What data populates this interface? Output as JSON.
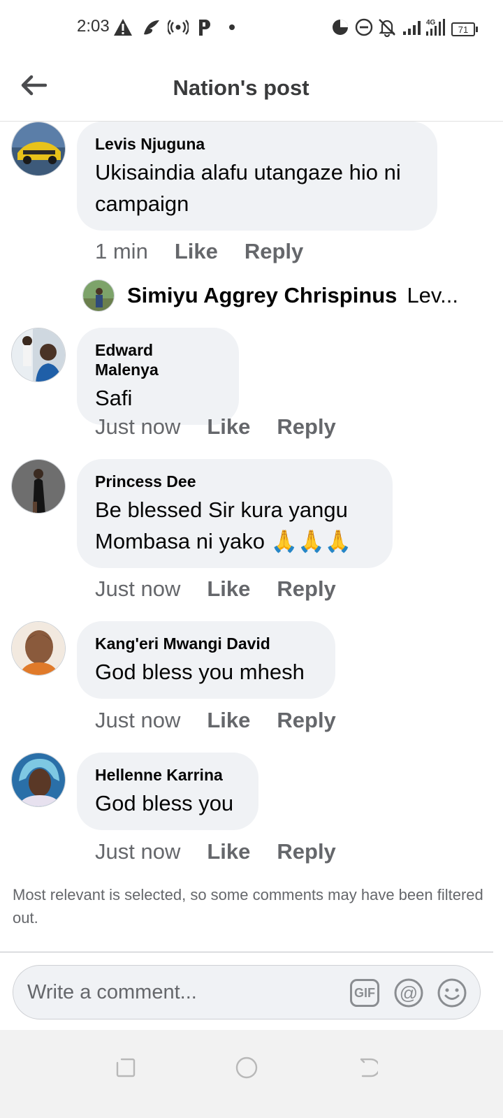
{
  "status_bar": {
    "time": "2:03",
    "battery": "71",
    "network": "4G",
    "icons": [
      "warning-icon",
      "feather-app-icon",
      "hotspot-icon",
      "parking-app-icon",
      "dot-icon",
      "data-saver-icon",
      "do-not-disturb-icon",
      "bell-off-icon",
      "signal-icon",
      "signal-4g-icon",
      "battery-icon"
    ]
  },
  "header": {
    "title": "Nation's post",
    "back_icon": "arrow-left-icon"
  },
  "comments": [
    {
      "name": "Levis Njuguna",
      "text": "Ukisaindia alafu utangaze hio ni\ncampaign",
      "time": "1 min",
      "like": "Like",
      "reply": "Reply",
      "reply_preview": {
        "name": "Simiyu Aggrey Chrispinus",
        "snippet": "Lev..."
      }
    },
    {
      "name": "Edward Malenya",
      "text": "Safi",
      "time": "Just now",
      "like": "Like",
      "reply": "Reply"
    },
    {
      "name": "Princess Dee",
      "text": "Be blessed Sir kura yangu\nMombasa ni yako 🙏🙏🙏",
      "time": "Just now",
      "like": "Like",
      "reply": "Reply"
    },
    {
      "name": "Kang'eri Mwangi David",
      "text": "God bless you mhesh",
      "time": "Just now",
      "like": "Like",
      "reply": "Reply"
    },
    {
      "name": "Hellenne Karrina",
      "text": "God bless you",
      "time": "Just now",
      "like": "Like",
      "reply": "Reply"
    }
  ],
  "filter_note": "Most relevant is selected, so some comments may have been filtered out.",
  "composer": {
    "placeholder": "Write a comment...",
    "gif_label": "GIF",
    "icons": [
      "gif-icon",
      "mention-icon",
      "emoji-icon"
    ]
  },
  "nav_bar": {
    "icons": [
      "recents-icon",
      "home-icon",
      "back-icon"
    ]
  },
  "colors": {
    "bubble": "#f0f2f5",
    "secondary_text": "#65676b",
    "primary_text": "#050505"
  }
}
